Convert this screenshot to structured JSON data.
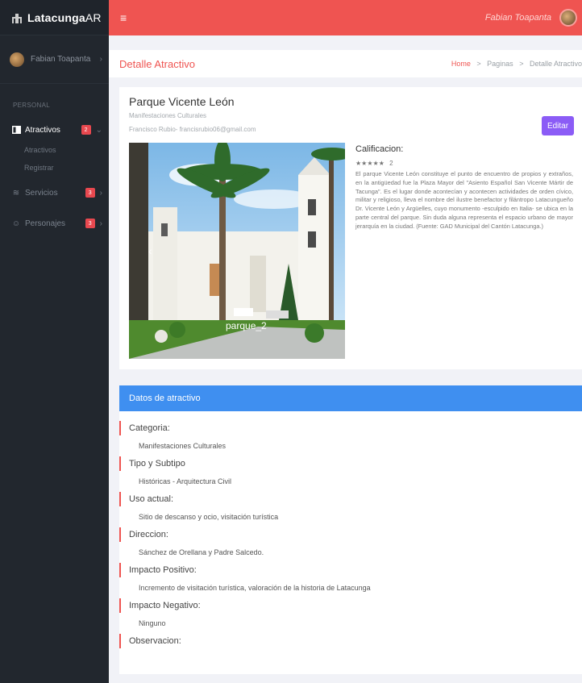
{
  "brand": {
    "name_bold": "Latacunga",
    "name_light": "AR",
    "icon": "building-icon"
  },
  "user": {
    "name": "Fabian Toapanta"
  },
  "sidebar": {
    "section": "PERSONAL",
    "items": [
      {
        "label": "Atractivos",
        "badge": "2",
        "icon": "image-icon"
      },
      {
        "label": "Servicios",
        "badge": "3",
        "icon": "layers-icon"
      },
      {
        "label": "Personajes",
        "badge": "3",
        "icon": "smile-icon"
      }
    ],
    "subitems": [
      "Atractivos",
      "Registrar"
    ]
  },
  "topbar": {
    "menu_icon": "≡",
    "user_name": "Fabian Toapanta"
  },
  "breadcrumb": {
    "title": "Detalle Atractivo",
    "home": "Home",
    "sep": ">",
    "pages": "Paginas",
    "current": "Detalle Atractivo"
  },
  "detail": {
    "title": "Parque Vicente León",
    "category": "Manifestaciones Culturales",
    "author": "Francisco Rubio- francisrubio06@gmail.com",
    "edit_label": "Editar",
    "image_caption": "parque_2",
    "rating_title": "Calificacion:",
    "stars": "★★★★★",
    "rating_value": "2",
    "description": "El parque Vicente León constituye el punto de encuentro de propios y extraños, en la antigüedad fue la Plaza Mayor del \"Asiento Español San Vicente Mártir de Tacunga\". Es el lugar donde acontecían y acontecen actividades de orden cívico, militar y religioso, lleva el nombre del ilustre benefactor y filántropo Latacungueño Dr. Vicente León y Argüelles, cuyo monumento -esculpido en Italia- se ubica en la parte central del parque. Sin duda alguna representa el espacio urbano de mayor jerarquía en la ciudad. (Fuente: GAD Municipal del Cantón Latacunga.)"
  },
  "datos": {
    "header": "Datos de atractivo",
    "fields": [
      {
        "label": "Categoria:",
        "value": "Manifestaciones Culturales"
      },
      {
        "label": "Tipo y Subtipo",
        "value": "Históricas - Arquitectura Civil"
      },
      {
        "label": "Uso actual:",
        "value": "Sitio de descanso y ocio, visitación turística"
      },
      {
        "label": "Direccion:",
        "value": "Sánchez de Orellana y Padre Salcedo."
      },
      {
        "label": "Impacto Positivo:",
        "value": "Incremento de visitación turística, valoración de la historia de Latacunga"
      },
      {
        "label": "Impacto Negativo:",
        "value": "Ninguno"
      },
      {
        "label": "Observacion:",
        "value": ""
      }
    ]
  },
  "colors": {
    "topbar": "#ef5451",
    "sidebar": "#22272e",
    "accent_blue": "#3f8ff0",
    "edit_button": "#8b5cf6",
    "badge": "#e8484f"
  }
}
